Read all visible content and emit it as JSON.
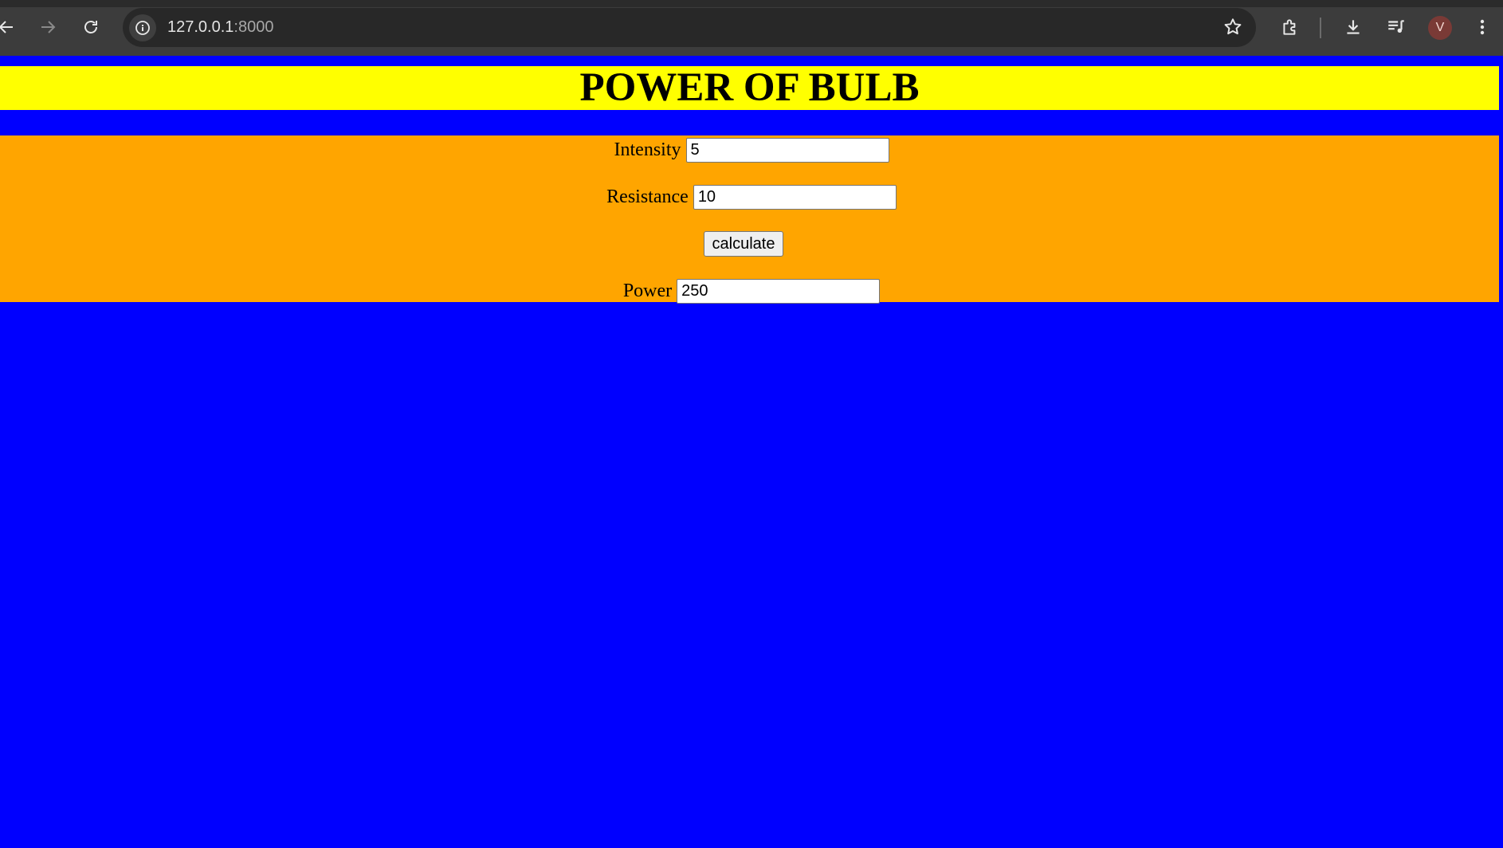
{
  "browser": {
    "url_host": "127.0.0.1",
    "url_port": ":8000",
    "avatar_letter": "V",
    "icons": {
      "back": "back-arrow-icon",
      "forward": "forward-arrow-icon",
      "reload": "reload-icon",
      "site_info": "info-icon",
      "bookmark": "star-icon",
      "extensions": "puzzle-icon",
      "downloads": "download-icon",
      "media": "media-queue-icon",
      "menu": "kebab-menu-icon"
    }
  },
  "page": {
    "title": "POWER OF BULB",
    "colors": {
      "background": "#0000ff",
      "header": "#ffff00",
      "form": "#ffa500"
    },
    "form": {
      "intensity_label": "Intensity",
      "intensity_value": "5",
      "resistance_label": "Resistance",
      "resistance_value": "10",
      "calculate_label": "calculate",
      "power_label": "Power",
      "power_value": "250"
    }
  }
}
